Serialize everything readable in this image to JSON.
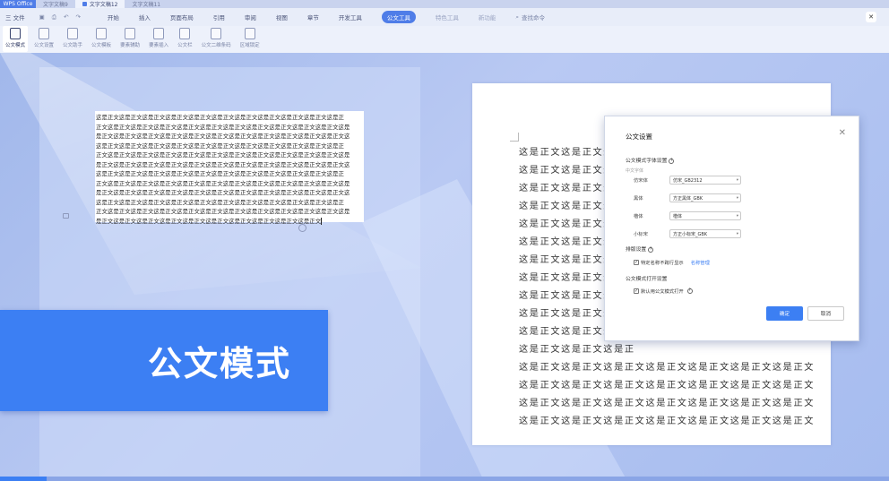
{
  "tabbar": {
    "brand": "WPS Office",
    "tabs": [
      {
        "label": "文字文稿9",
        "active": false
      },
      {
        "label": "文字文稿12",
        "active": true
      },
      {
        "label": "文字文稿11",
        "active": false
      }
    ]
  },
  "menubar": {
    "file": "三 文件",
    "items": [
      "开始",
      "插入",
      "页面布局",
      "引用",
      "审阅",
      "视图",
      "章节",
      "开发工具"
    ],
    "active": "公文工具",
    "faded": [
      "特色工具",
      "新功能"
    ],
    "search": "查找命令"
  },
  "ribbon": {
    "buttons": [
      {
        "label": "公文模式",
        "active": true
      },
      {
        "label": "公文设置"
      },
      {
        "label": "公文助手"
      },
      {
        "label": "公文模板"
      },
      {
        "label": "要素辅助"
      },
      {
        "label": "要素插入"
      },
      {
        "label": "公文栏"
      },
      {
        "label": "公文二维条码"
      },
      {
        "label": "区域锁定"
      }
    ]
  },
  "left_text": {
    "lines": [
      "这是正文这是正文这是正文这是正文这是正文这是正文这是正文这是正文这是正文这是正文这是正",
      "正文这是正文这是正文这是正文这是正文这是正文这是正文这是正文这是正文这是正文这是正文这是",
      "是正文这是正文这是正文这是正文这是正文这是正文这是正文这是正文这是正文这是正文这是正文这",
      "这是正文这是正文这是正文这是正文这是正文这是正文这是正文这是正文这是正文这是正文这是正",
      "正文这是正文这是正文这是正文这是正文这是正文这是正文这是正文这是正文这是正文这是正文这是",
      "是正文这是正文这是正文这是正文这是正文这是正文这是正文这是正文这是正文这是正文这是正文这",
      "这是正文这是正文这是正文这是正文这是正文这是正文这是正文这是正文这是正文这是正文这是正",
      "正文这是正文这是正文这是正文这是正文这是正文这是正文这是正文这是正文这是正文这是正文这是",
      "是正文这是正文这是正文这是正文这是正文这是正文这是正文这是正文这是正文这是正文这是正文这",
      "这是正文这是正文这是正文这是正文这是正文这是正文这是正文这是正文这是正文这是正文这是正",
      "正文这是正文这是正文这是正文这是正文这是正文这是正文这是正文这是正文这是正文这是正文这是"
    ],
    "last_line": "是正文这是正文这是正文这是正文这是正文这是正文这是正文这是正文这是正文这是正文"
  },
  "banner": {
    "text": "公文模式"
  },
  "right_text": {
    "short_lines": [
      "这是正文这是正文这是正",
      "这是正文这是正文这是正",
      "这是正文这是正文这是正",
      "这是正文这是正文这是正",
      "这是正文这是正文这是正",
      "这是正文这是正文这是正",
      "这是正文这是正文这是正",
      "这是正文这是正文这是正",
      "这是正文这是正文这是正",
      "这是正文这是正文这是正",
      "这是正文这是正文这是正",
      "这是正文这是正文这是正"
    ],
    "long_lines": [
      "这是正文这是正文这是正文这是正文这是正文这是正文这是正文",
      "这是正文这是正文这是正文这是正文这是正文这是正文这是正文",
      "这是正文这是正文这是正文这是正文这是正文这是正文这是正文",
      "这是正文这是正文这是正文这是正文这是正文这是正文这是正文"
    ]
  },
  "dialog": {
    "title": "公文设置",
    "close": "✕",
    "font_section": "公文模式字体设置",
    "font_sub": "中文字体",
    "fonts": [
      {
        "label": "仿宋体",
        "value": "仿宋_GB2312"
      },
      {
        "label": "黑体",
        "value": "方正黑体_GBK"
      },
      {
        "label": "楷体",
        "value": "楷体"
      },
      {
        "label": "小标宋",
        "value": "方正小标宋_GBK"
      }
    ],
    "layout_section": "排版设置",
    "layout_check": "特定名称不跨行显示",
    "layout_link": "名称管理",
    "open_section": "公文模式打开设置",
    "open_check": "默认用公文模式打开",
    "ok": "确定",
    "cancel": "取消"
  },
  "colors": {
    "accent": "#3c7ff3",
    "background": "#b2c4f0"
  }
}
